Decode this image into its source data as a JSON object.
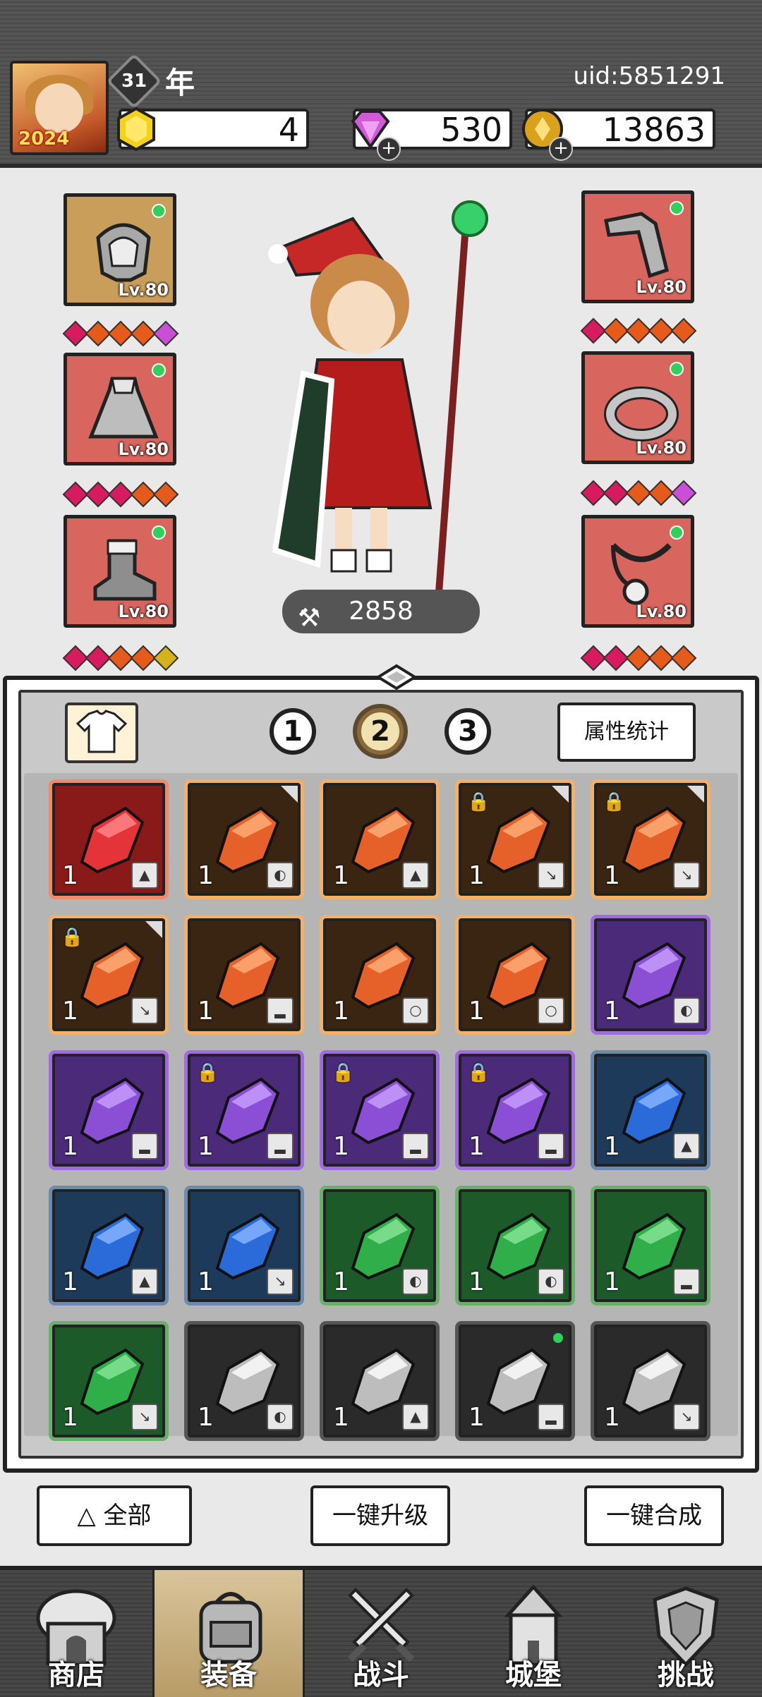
{
  "header": {
    "year_number": "31",
    "year_label": "年",
    "uid": "uid:5851291",
    "avatar_badge": "2024"
  },
  "resources": [
    {
      "name": "gold-gem",
      "value": "4",
      "color": "#f5d21a"
    },
    {
      "name": "purple-diamond",
      "value": "530",
      "color": "#d05ad8"
    },
    {
      "name": "gold-coin",
      "value": "13863",
      "color": "#d9a21a"
    }
  ],
  "equipment": {
    "left": [
      {
        "slot": "helmet",
        "level": "Lv.80",
        "stars": [
          "#d81b60",
          "#e65a1a",
          "#e65a1a",
          "#e65a1a",
          "#c84fd6"
        ]
      },
      {
        "slot": "cape",
        "level": "Lv.80",
        "stars": [
          "#d81b60",
          "#d81b60",
          "#d81b60",
          "#e65a1a",
          "#e65a1a"
        ]
      },
      {
        "slot": "boots",
        "level": "Lv.80",
        "stars": [
          "#d81b60",
          "#d81b60",
          "#e65a1a",
          "#e65a1a",
          "#d4b21a"
        ]
      }
    ],
    "right": [
      {
        "slot": "bracer",
        "level": "Lv.80",
        "stars": [
          "#d81b60",
          "#e65a1a",
          "#e65a1a",
          "#e65a1a",
          "#e65a1a"
        ]
      },
      {
        "slot": "ring",
        "level": "Lv.80",
        "stars": [
          "#d81b60",
          "#d81b60",
          "#e65a1a",
          "#e65a1a",
          "#c84fd6"
        ]
      },
      {
        "slot": "necklace",
        "level": "Lv.80",
        "stars": [
          "#d81b60",
          "#d81b60",
          "#e65a1a",
          "#e65a1a",
          "#e65a1a"
        ]
      }
    ]
  },
  "power": "2858",
  "sets": [
    "1",
    "2",
    "3"
  ],
  "active_set": "2",
  "stats_button": "属性统计",
  "inventory_qty": "1",
  "footer_buttons": {
    "filter": "全部",
    "upgrade": "一键升级",
    "merge": "一键合成"
  },
  "nav": [
    {
      "label": "商店",
      "icon": "shop-icon"
    },
    {
      "label": "装备",
      "icon": "backpack-icon"
    },
    {
      "label": "战斗",
      "icon": "crossed-swords-icon"
    },
    {
      "label": "城堡",
      "icon": "castle-icon"
    },
    {
      "label": "挑战",
      "icon": "challenge-shield-icon"
    }
  ],
  "active_nav": "装备",
  "rarity_colors": {
    "red": "#8a1a1a",
    "orange": "#3a2412",
    "purple": "#4b2a7a",
    "blue": "#1e3a5a",
    "green": "#1c5a2a",
    "gray": "#2a2a2a"
  }
}
